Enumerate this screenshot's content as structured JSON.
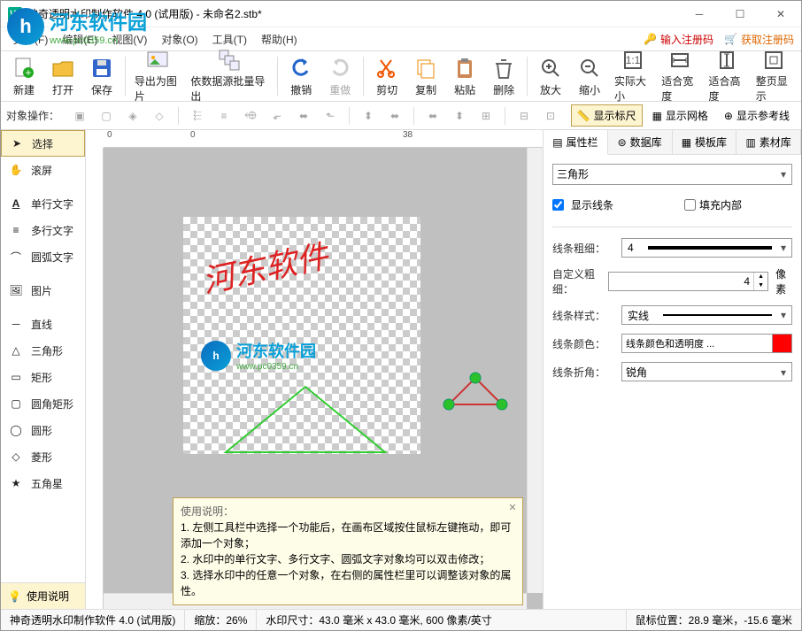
{
  "title": "神奇透明水印制作软件 4.0 (试用版) - 未命名2.stb*",
  "menu": {
    "file": "文件(F)",
    "edit": "编辑(E)",
    "view": "视图(V)",
    "object": "对象(O)",
    "tools": "工具(T)",
    "help": "帮助(H)"
  },
  "reg": {
    "input": "输入注册码",
    "get": "获取注册码"
  },
  "toolbar": {
    "new": "新建",
    "open": "打开",
    "save": "保存",
    "export_img": "导出为图片",
    "batch": "依数据源批量导出",
    "undo": "撤销",
    "redo": "重做",
    "cut": "剪切",
    "copy": "复制",
    "paste": "粘贴",
    "delete": "删除",
    "zoomin": "放大",
    "zoomout": "缩小",
    "actual": "实际大小",
    "fitw": "适合宽度",
    "fith": "适合高度",
    "fitpage": "整页显示"
  },
  "subbar": {
    "label": "对象操作：",
    "ruler": "显示标尺",
    "grid": "显示网格",
    "guide": "显示参考线"
  },
  "tools": {
    "select": "选择",
    "pan": "滚屏",
    "text1": "单行文字",
    "text2": "多行文字",
    "arc": "圆弧文字",
    "image": "图片",
    "line": "直线",
    "triangle": "三角形",
    "rect": "矩形",
    "roundrect": "圆角矩形",
    "ellipse": "圆形",
    "diamond": "菱形",
    "star": "五角星",
    "help": "使用说明"
  },
  "canvas": {
    "watermark_text": "河东软件",
    "logo_text": "河东软件园",
    "logo_url": "www.pc0359.cn"
  },
  "ruler": {
    "t0": "0",
    "t1": "0",
    "t2": "38"
  },
  "rightpanel": {
    "tabs": {
      "props": "属性栏",
      "db": "数据库",
      "tpl": "模板库",
      "res": "素材库"
    },
    "shape": "三角形",
    "show_line": "显示线条",
    "fill": "填充内部",
    "thickness_label": "线条粗细：",
    "thickness": "4",
    "custom_label": "自定义粗细：",
    "custom": "4",
    "custom_unit": "像素",
    "style_label": "线条样式：",
    "style": "实线",
    "color_label": "线条颜色：",
    "color_text": "线条颜色和透明度 ...",
    "join_label": "线条折角：",
    "join": "锐角"
  },
  "tips": {
    "title": "使用说明：",
    "l1": "1. 左侧工具栏中选择一个功能后，在画布区域按住鼠标左键拖动，即可添加一个对象；",
    "l2": "2. 水印中的单行文字、多行文字、圆弧文字对象均可以双击修改；",
    "l3": "3. 选择水印中的任意一个对象，在右侧的属性栏里可以调整该对象的属性。"
  },
  "status": {
    "app": "神奇透明水印制作软件 4.0 (试用版)",
    "zoom": "缩放：26%",
    "size": "水印尺寸：43.0 毫米 x 43.0 毫米, 600 像素/英寸",
    "mouse": "鼠标位置：28.9 毫米，-15.6 毫米"
  }
}
